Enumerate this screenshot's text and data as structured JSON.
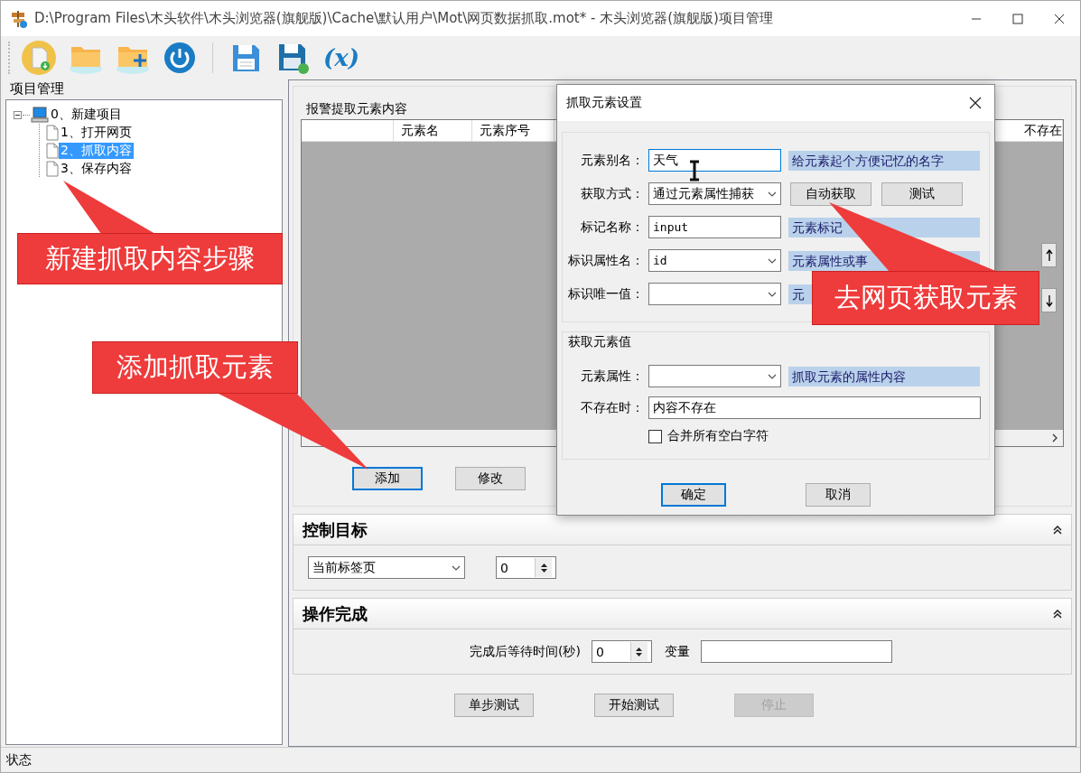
{
  "window": {
    "title": "D:\\Program Files\\木头软件\\木头浏览器(旗舰版)\\Cache\\默认用户\\Mot\\网页数据抓取.mot* - 木头浏览器(旗舰版)项目管理"
  },
  "toolbar": [
    {
      "kind": "new"
    },
    {
      "kind": "open"
    },
    {
      "kind": "open-add"
    },
    {
      "kind": "power"
    },
    {
      "kind": "separator"
    },
    {
      "kind": "save"
    },
    {
      "kind": "save-as"
    },
    {
      "kind": "variable",
      "text": "(x)"
    }
  ],
  "project_panel": {
    "title": "项目管理",
    "tree": [
      {
        "label": "0、新建项目",
        "expanded": true,
        "selected": false,
        "children": [
          {
            "label": "1、打开网页",
            "selected": false
          },
          {
            "label": "2、抓取内容",
            "selected": true
          },
          {
            "label": "3、保存内容",
            "selected": false
          }
        ]
      }
    ]
  },
  "element_group": {
    "title": "报警提取元素内容",
    "table": {
      "columns": [
        "",
        "元素名",
        "元素序号",
        "不存在"
      ]
    },
    "buttons": [
      {
        "label": "添加",
        "focused": true
      },
      {
        "label": "修改",
        "focused": false
      }
    ]
  },
  "control_target": {
    "title": "控制目标",
    "expanded": true,
    "target": "当前标签页",
    "index": "0"
  },
  "done_section": {
    "title": "操作完成",
    "expanded": true,
    "wait_label": "完成后等待时间(秒)",
    "wait": "0",
    "variable_label": "变量"
  },
  "action_buttons": [
    {
      "label": "单步测试",
      "disabled": false
    },
    {
      "label": "开始测试",
      "disabled": false
    },
    {
      "label": "停止",
      "disabled": true
    }
  ],
  "status_bar": {
    "text": "状态"
  },
  "dialog": {
    "title": "抓取元素设置",
    "rows": [
      {
        "kind": "text",
        "label": "元素别名：",
        "value": "天气",
        "hint": "给元素起个方便记忆的名字",
        "focused": true
      },
      {
        "kind": "select",
        "label": "获取方式：",
        "value": "通过元素属性捕获",
        "buttons": [
          "自动获取",
          "测试"
        ]
      },
      {
        "kind": "text",
        "label": "标记名称：",
        "value": "input",
        "hint": "元素标记",
        "focused": false
      },
      {
        "kind": "combo",
        "label": "标识属性名：",
        "value": "id",
        "hint": "元素属性或事"
      },
      {
        "kind": "combo",
        "label": "标识唯一值：",
        "hint": "元"
      }
    ],
    "value_group": {
      "title": "获取元素值",
      "rows": [
        {
          "kind": "combo",
          "label": "元素属性：",
          "hint": "抓取元素的属性内容"
        },
        {
          "kind": "wide-text",
          "label": "不存在时：",
          "value": "内容不存在",
          "focused": false
        }
      ],
      "checkbox": {
        "label": "合并所有空白字符",
        "checked": false
      }
    },
    "buttons": [
      {
        "label": "确定",
        "focused": true
      },
      {
        "label": "取消",
        "focused": false
      }
    ]
  },
  "callouts": [
    {
      "text": "新建抓取内容步骤"
    },
    {
      "text": "添加抓取元素"
    },
    {
      "text": "去网页获取元素"
    }
  ]
}
